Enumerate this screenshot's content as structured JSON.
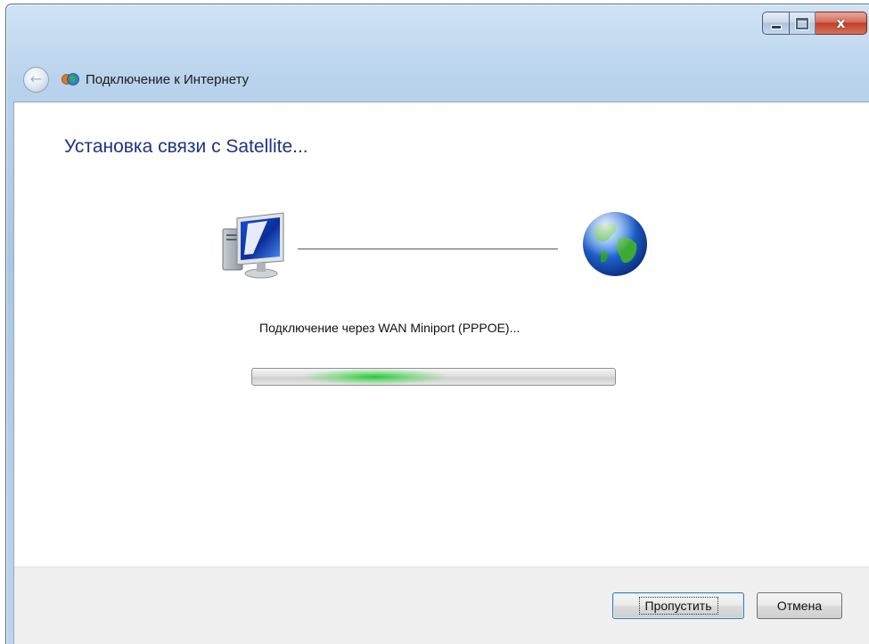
{
  "window": {
    "title": "Подключение к Интернету",
    "caption_buttons": {
      "minimize": "minimize",
      "maximize": "maximize",
      "close": "x"
    }
  },
  "main": {
    "heading": "Установка связи с Satellite...",
    "status_text": "Подключение через WAN Miniport (PPPOE)...",
    "progress": {
      "mode": "indeterminate",
      "glow_fraction": 0.35
    }
  },
  "footer": {
    "skip_label": "Пропустить",
    "cancel_label": "Отмена"
  },
  "icons": [
    "back-arrow-icon",
    "network-globe-icon",
    "computer-icon",
    "globe-icon"
  ],
  "colors": {
    "heading": "#1e3287",
    "progress_glow": "#1ec832",
    "close_button": "#c84a33"
  }
}
